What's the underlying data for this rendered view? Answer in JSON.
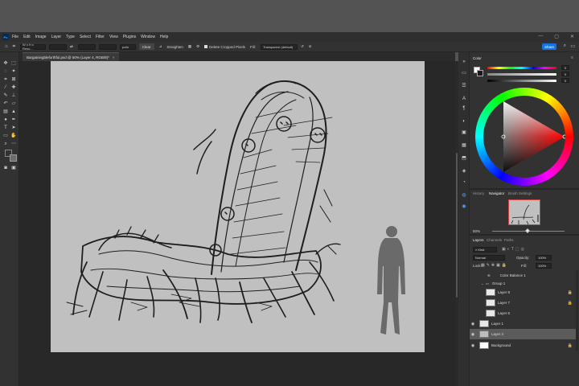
{
  "app": {
    "logo": "Ps"
  },
  "menu": [
    "File",
    "Edit",
    "Image",
    "Layer",
    "Type",
    "Select",
    "Filter",
    "View",
    "Plugins",
    "Window",
    "Help"
  ],
  "window_controls": [
    "—",
    "▢",
    "✕"
  ],
  "options_bar": {
    "ratio_value": "W x H x Reso...",
    "units": "px/in",
    "clear_label": "Clear",
    "straighten_label": "Straighten",
    "delete_cropped_label": "Delete Cropped Pixels",
    "fill_label": "Fill:",
    "fill_value": "Transparent (default)",
    "share_label": "Share"
  },
  "document_tab": {
    "title": "Bargainingbleforthful.psd @ 50% (Layer 4, RGB/8)*",
    "close": "×"
  },
  "color_panel": {
    "tab": "Color",
    "swatch_fg": "#1a1a1a",
    "swatch_bg": "#ffffff",
    "values": [
      "0",
      "0",
      "0"
    ]
  },
  "nav_panel": {
    "tabs": [
      "History",
      "Navigator",
      "Brush Settings"
    ],
    "active": "Navigator",
    "zoom": "50%"
  },
  "layers_panel": {
    "tabs": [
      "Layers",
      "Channels",
      "Paths"
    ],
    "filter_label": "Kind",
    "blend_mode": "Normal",
    "opacity_label": "Opacity:",
    "opacity": "100%",
    "lock_label": "Lock:",
    "fill_label": "Fill:",
    "fill": "100%",
    "layers": [
      {
        "name": "Color Balance 1",
        "type": "adjustment",
        "visible": false,
        "indent": true
      },
      {
        "name": "Group 1",
        "type": "group",
        "visible": false,
        "indent": false
      },
      {
        "name": "Layer 8",
        "type": "layer",
        "visible": false,
        "indent": true,
        "locked": true
      },
      {
        "name": "Layer 7",
        "type": "layer",
        "visible": false,
        "indent": true,
        "locked": true
      },
      {
        "name": "Layer 6",
        "type": "layer",
        "visible": false,
        "indent": true
      },
      {
        "name": "Layer 1",
        "type": "layer",
        "visible": true,
        "indent": false
      },
      {
        "name": "Layer 4",
        "type": "layer",
        "visible": true,
        "indent": false,
        "selected": true
      },
      {
        "name": "Background",
        "type": "background",
        "visible": true,
        "indent": false,
        "locked": true
      }
    ]
  },
  "toolbar_icons": [
    "move-icon",
    "marquee-icon",
    "lasso-icon",
    "magic-wand-icon",
    "crop-icon",
    "frame-icon",
    "eyedropper-icon",
    "healing-icon",
    "brush-icon",
    "stamp-icon",
    "history-brush-icon",
    "eraser-icon",
    "gradient-icon",
    "blur-icon",
    "dodge-icon",
    "pen-icon",
    "type-icon",
    "path-select-icon",
    "shape-icon",
    "hand-icon",
    "zoom-icon",
    "more-icon"
  ]
}
